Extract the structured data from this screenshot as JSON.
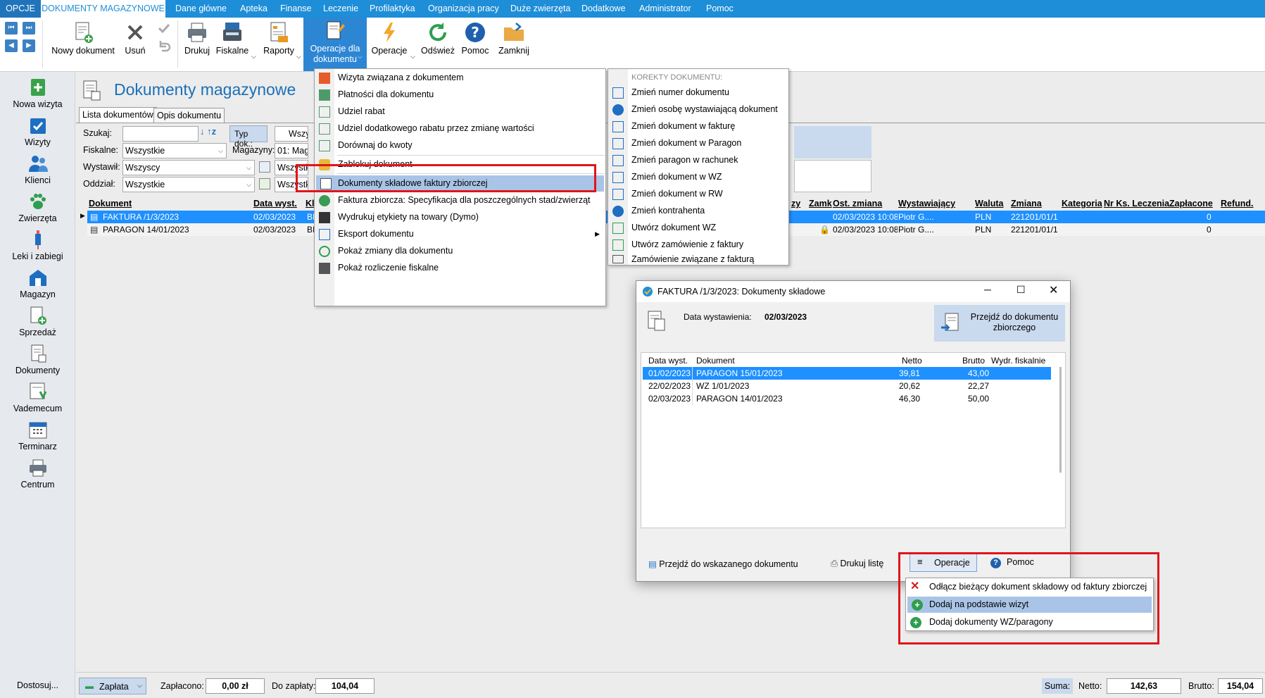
{
  "menubar": {
    "opcje": "OPCJE",
    "active": "DOKUMENTY MAGAZYNOWE",
    "items": [
      "Dane główne",
      "Apteka",
      "Finanse",
      "Leczenie",
      "Profilaktyka",
      "Organizacja pracy",
      "Duże zwierzęta",
      "Dodatkowe",
      "Administrator",
      "Pomoc"
    ]
  },
  "toolbar": {
    "new_doc": "Nowy dokument",
    "delete": "Usuń",
    "print": "Drukuj",
    "fiscal": "Fiskalne",
    "reports": "Raporty",
    "doc_ops_line1": "Operacje dla",
    "doc_ops_line2": "dokumentu",
    "ops": "Operacje",
    "refresh": "Odśwież",
    "help": "Pomoc",
    "close": "Zamknij"
  },
  "sidebar": {
    "items": [
      "Nowa wizyta",
      "Wizyty",
      "Klienci",
      "Zwierzęta",
      "Leki i zabiegi",
      "Magazyn",
      "Sprzedaż",
      "Dokumenty",
      "Vademecum",
      "Terminarz",
      "Centrum"
    ],
    "customize": "Dostosuj..."
  },
  "main": {
    "title": "Dokumenty magazynowe",
    "tabs": [
      "Lista dokumentów",
      "Opis dokumentu"
    ],
    "filters": {
      "search_label": "Szukaj:",
      "doc_type_label": "Typ dok.:",
      "doc_type_value": "Wszys",
      "fiscal_label": "Fiskalne:",
      "fiscal_value": "Wszystkie",
      "warehouse_label": "Magazyny:",
      "warehouse_value": "01: Magaz",
      "issued_label": "Wystawił:",
      "issued_value": "Wszyscy",
      "issued_value2": "Wszystk",
      "branch_label": "Oddział:",
      "branch_value": "Wszystkie",
      "branch_value2": "Wszystkie"
    },
    "columns_left": [
      "Dokument",
      "Data wyst.",
      "Kl"
    ],
    "columns_right": [
      "zy",
      "Zamk",
      "Ost. zmiana",
      "Wystawiający",
      "Waluta",
      "Zmiana",
      "Kategoria",
      "Nr Ks. Leczenia",
      "Zapłacone",
      "Refund."
    ],
    "rows": [
      {
        "doc": "FAKTURA /1/3/2023",
        "date": "02/03/2023",
        "kl": "BI",
        "changed": "02/03/2023 10:08",
        "issuer": "Piotr G....",
        "currency": "PLN",
        "change": "221201/01/1",
        "paid": "0"
      },
      {
        "doc": "PARAGON 14/01/2023",
        "date": "02/03/2023",
        "kl": "BI",
        "changed": "02/03/2023 10:08",
        "issuer": "Piotr G....",
        "currency": "PLN",
        "change": "221201/01/1",
        "paid": "0"
      }
    ]
  },
  "doc_ops_menu": {
    "items": [
      "Wizyta związana z dokumentem",
      "Płatności dla dokumentu",
      "Udziel rabat",
      "Udziel dodatkowego rabatu przez zmianę wartości",
      "Dorównaj do kwoty",
      "Zablokuj dokument",
      "Dokumenty składowe faktury zbiorczej",
      "Faktura zbiorcza: Specyfikacja dla poszczególnych stad/zwierząt",
      "Wydrukuj etykiety na towary (Dymo)",
      "Eksport dokumentu",
      "Pokaż zmiany dla dokumentu",
      "Pokaż rozliczenie fiskalne"
    ]
  },
  "corrections_menu": {
    "header": "KOREKTY DOKUMENTU:",
    "items": [
      "Zmień numer dokumentu",
      "Zmień osobę wystawiającą dokument",
      "Zmień dokument w fakturę",
      "Zmień dokument w Paragon",
      "Zmień paragon w rachunek",
      "Zmień dokument w WZ",
      "Zmień dokument w RW",
      "Zmień kontrahenta",
      "Utwórz dokument WZ",
      "Utwórz zamówienie z faktury",
      "Zamówienie związane z fakturą"
    ]
  },
  "dialog": {
    "title": "FAKTURA /1/3/2023: Dokumenty składowe",
    "date_label": "Data wystawienia:",
    "date_value": "02/03/2023",
    "goto_line1": "Przejdź do dokumentu",
    "goto_line2": "zbiorczego",
    "columns": [
      "Data wyst.",
      "Dokument",
      "Netto",
      "Brutto",
      "Wydr. fiskalnie"
    ],
    "rows": [
      {
        "date": "01/02/2023",
        "doc": "PARAGON 15/01/2023",
        "net": "39,81",
        "gross": "43,00"
      },
      {
        "date": "22/02/2023",
        "doc": "WZ 1/01/2023",
        "net": "20,62",
        "gross": "22,27"
      },
      {
        "date": "02/03/2023",
        "doc": "PARAGON 14/01/2023",
        "net": "46,30",
        "gross": "50,00"
      }
    ],
    "btn_goto": "Przejdź do wskazanego dokumentu",
    "btn_print": "Drukuj listę",
    "btn_ops": "Operacje",
    "btn_help": "Pomoc",
    "ops_menu": [
      "Odłącz bieżący dokument składowy od faktury zbiorczej",
      "Dodaj na podstawie wizyt",
      "Dodaj dokumenty WZ/paragony"
    ]
  },
  "statusbar": {
    "pay": "Zapłata",
    "paid_label": "Zapłacono:",
    "paid_value": "0,00 zł",
    "to_pay_label": "Do zapłaty:",
    "to_pay_value": "104,04",
    "sum": "Suma:",
    "net_label": "Netto:",
    "net_value": "142,63",
    "gross_label": "Brutto:",
    "gross_value": "154,04"
  },
  "colors": {
    "accent": "#1e8ed8",
    "selection": "#1e90ff",
    "highlight": "#a9c4e6",
    "red": "#e0151b"
  }
}
